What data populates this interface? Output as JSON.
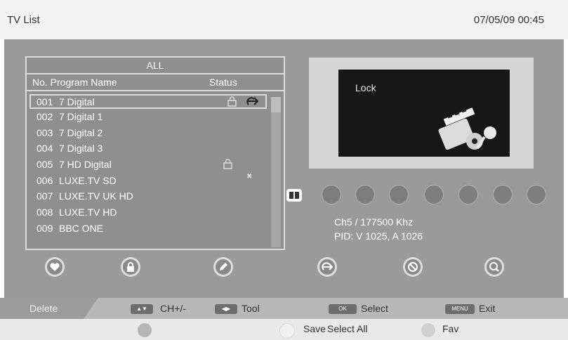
{
  "window": {
    "title": "TV List",
    "datetime": "07/05/09  00:45"
  },
  "list": {
    "group": "ALL",
    "headers": {
      "no_program": "No. Program Name",
      "status": "Status"
    },
    "rows": [
      {
        "no": "001",
        "name": "7   Digital",
        "selected": true,
        "status": [
          "lock-icon",
          "skip-icon"
        ]
      },
      {
        "no": "002",
        "name": "7   Digital   1",
        "selected": false,
        "status": []
      },
      {
        "no": "003",
        "name": "7   Digital    2",
        "selected": false,
        "status": []
      },
      {
        "no": "004",
        "name": "7   Digital    3",
        "selected": false,
        "status": []
      },
      {
        "no": "005",
        "name": "7   HD   Digital",
        "selected": false,
        "status": [
          "lock-icon"
        ]
      },
      {
        "no": "006",
        "name": "LUXE.TV SD",
        "selected": false,
        "status": [
          "delete-icon"
        ]
      },
      {
        "no": "007",
        "name": "LUXE.TV UK  HD",
        "selected": false,
        "status": []
      },
      {
        "no": "008",
        "name": "LUXE.TV HD",
        "selected": false,
        "status": []
      },
      {
        "no": "009",
        "name": "BBC  ONE",
        "selected": false,
        "status": []
      }
    ]
  },
  "preview": {
    "message": "Lock"
  },
  "categories": [
    "all-icon",
    "news-icon",
    "globe-icon",
    "music-icon",
    "movie-icon",
    "sports-icon",
    "kids-icon",
    "people-icon"
  ],
  "channel_info": {
    "frequency": "Ch5 / 177500  Khz",
    "pid": "PID: V 1025, A 1026"
  },
  "function_buttons": [
    "favorite-icon",
    "lock-icon",
    "rename-icon",
    "skip-icon",
    "delete-icon",
    "find-icon"
  ],
  "help_bar": {
    "delete": "Delete",
    "ch_key": "▲▼",
    "ch": "CH+/-",
    "tool_key": "◀▶",
    "tool": "Tool",
    "ok_key": "OK",
    "select": "Select",
    "menu_key": "MENU",
    "exit": "Exit"
  },
  "bottom_bar": {
    "save": "Save",
    "select_all": "Select  All",
    "fav": "Fav"
  },
  "colors": {
    "main_bg": "#9a9a9a",
    "selection_border": "#dcdcdc",
    "preview_frame": "#d6d6d6",
    "screen": "#161616"
  }
}
